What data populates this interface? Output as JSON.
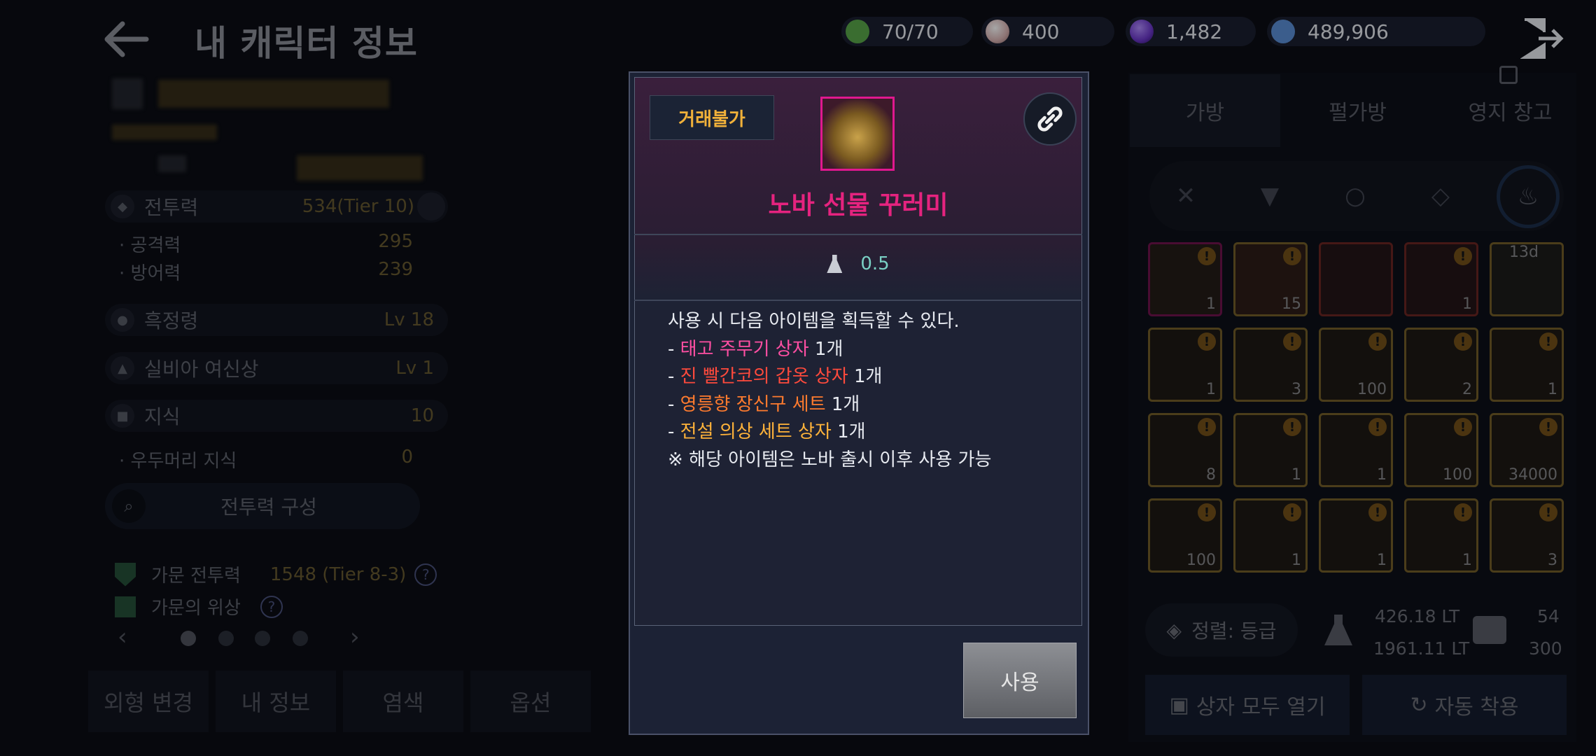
{
  "header": {
    "title": "내 캐릭터 정보",
    "currencies": [
      {
        "name": "stamina",
        "value": "70/70",
        "icon": "leaf-icon",
        "color": "#5aa84a"
      },
      {
        "name": "pearl",
        "value": "400",
        "icon": "pearl-icon",
        "color": "#d9b3b3"
      },
      {
        "name": "crystal",
        "value": "1,482",
        "icon": "crystal-icon",
        "color": "#6a36c9"
      },
      {
        "name": "silver",
        "value": "489,906",
        "icon": "silver-coin-icon",
        "color": "#5b8fd8"
      }
    ]
  },
  "left_panel": {
    "combat_power": {
      "label": "전투력",
      "value": "534(Tier 10)"
    },
    "attack": {
      "label": "공격력",
      "value": "295"
    },
    "defense": {
      "label": "방어력",
      "value": "239"
    },
    "black_spirit": {
      "label": "흑정령",
      "value": "Lv 18"
    },
    "silvia": {
      "label": "실비아 여신상",
      "value": "Lv 1"
    },
    "knowledge": {
      "label": "지식",
      "value": "10"
    },
    "uduma": {
      "label": "우두머리 지식",
      "value": "0"
    },
    "combat_build_label": "전투력 구성",
    "family_power": {
      "label": "가문 전투력",
      "value": "1548 (Tier 8-3)"
    },
    "family_prestige": {
      "label": "가문의 위상"
    },
    "help_mark": "?",
    "bottom_tabs": [
      "외형 변경",
      "내 정보",
      "염색",
      "옵션"
    ]
  },
  "right_panel": {
    "tabs": [
      "가방",
      "펄가방",
      "영지 창고"
    ],
    "inventory_counts": [
      [
        "1",
        "15",
        "",
        "1",
        ""
      ],
      [
        "1",
        "3",
        "100",
        "2",
        "1"
      ],
      [
        "8",
        "1",
        "1",
        "100",
        "34000"
      ],
      [
        "100",
        "1",
        "1",
        "1",
        "3"
      ]
    ],
    "timer_label": "13d",
    "sort_label": "정렬: 등급",
    "weight_current": "426.18 LT",
    "weight_max": "1961.11 LT",
    "slots_current": "54",
    "slots_max": "300",
    "open_all_label": "상자 모두 열기",
    "auto_equip_label": "자동 착용"
  },
  "popup": {
    "trade_tag": "거래불가",
    "item_name": "노바 선물 꾸러미",
    "weight": "0.5",
    "desc_intro": "사용 시 다음 아이템을 획득할 수 있다.",
    "rewards": [
      {
        "name": "태고 주무기 상자",
        "qty": "1개",
        "color": "pink"
      },
      {
        "name": "진 빨간코의 갑옷 상자",
        "qty": "1개",
        "color": "red"
      },
      {
        "name": "영릉향 장신구 세트",
        "qty": "1개",
        "color": "orange"
      },
      {
        "name": "전설 의상 세트 상자",
        "qty": "1개",
        "color": "gold"
      }
    ],
    "note": "※ 해당 아이템은 노바 출시 이후 사용 가능",
    "use_label": "사용"
  },
  "colors": {
    "item_name": "#e5237f",
    "trade_tag": "#f1b13a",
    "accent_gold": "#b79b4a"
  }
}
